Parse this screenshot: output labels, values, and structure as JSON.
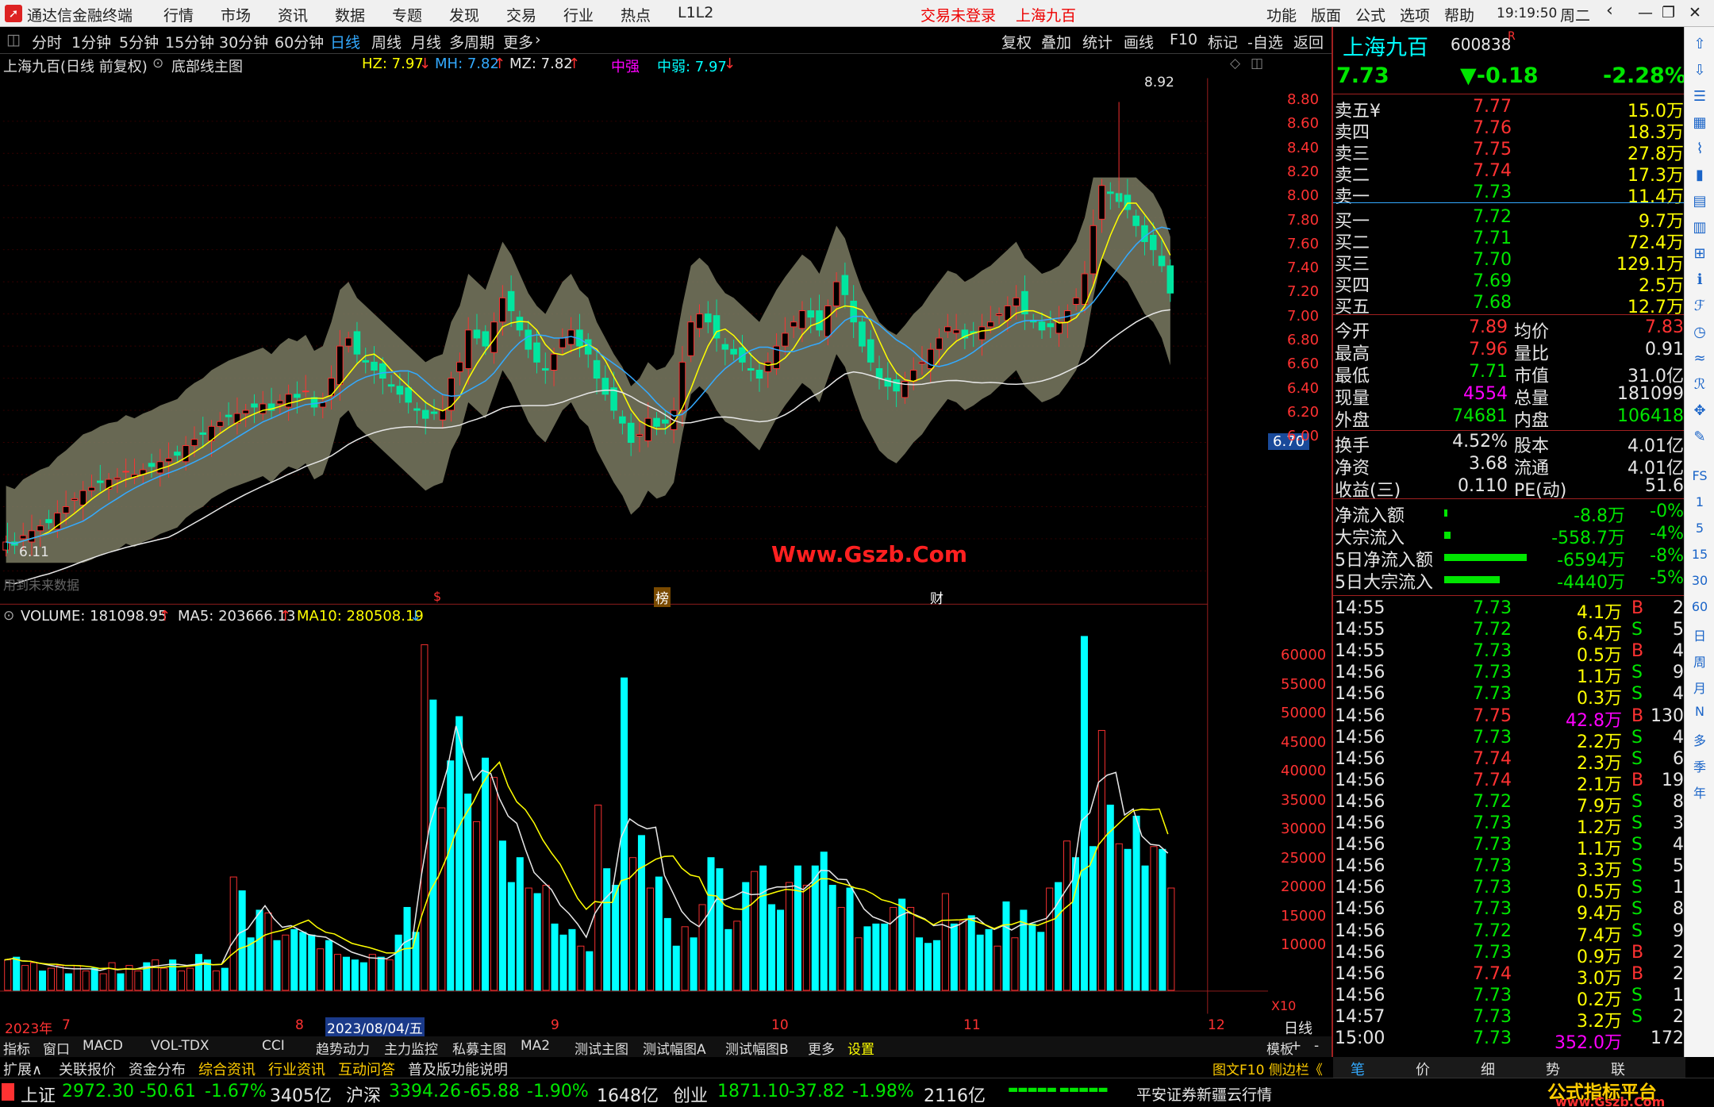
{
  "app": {
    "title": "通达信金融终端",
    "menus": [
      "行情",
      "市场",
      "资讯",
      "数据",
      "专题",
      "发现",
      "交易",
      "行业",
      "热点",
      "L1L2"
    ],
    "login": "交易未登录",
    "stock_name": "上海九百",
    "right_menus": [
      "功能",
      "版面",
      "公式",
      "选项",
      "帮助"
    ],
    "time": "19:19:50",
    "weekday": "周二"
  },
  "toolbar": {
    "periods": [
      "分时",
      "1分钟",
      "5分钟",
      "15分钟",
      "30分钟",
      "60分钟",
      "日线",
      "周线",
      "月线",
      "多周期",
      "更多"
    ],
    "active": "日线",
    "tools": [
      "复权",
      "叠加",
      "统计",
      "画线",
      "F10",
      "标记",
      "-自选",
      "返回"
    ]
  },
  "kline": {
    "title": "上海九百(日线 前复权)",
    "indicator": "底部线主图",
    "hz": "HZ: 7.97",
    "mh": "MH: 7.82",
    "mz": "MZ: 7.82",
    "zq": "中强",
    "zr": "中弱: 7.97",
    "price_label_high": "8.92",
    "price_label_low": "6.11",
    "current_tag": "6.70",
    "watermark": "Www.Gszb.Com",
    "note": "用到未来数据",
    "markers": [
      "$",
      "榜",
      "财"
    ]
  },
  "chart_data": [
    {
      "type": "candlestick",
      "title": "上海九百(日线 前复权)",
      "ylim": [
        6.0,
        8.9
      ],
      "yticks": [
        "8.80",
        "8.60",
        "8.40",
        "8.20",
        "8.00",
        "7.80",
        "7.60",
        "7.40",
        "7.20",
        "7.00",
        "6.80",
        "6.60",
        "6.40",
        "6.20",
        "6.00"
      ],
      "high": 8.92,
      "low": 6.11
    },
    {
      "type": "bar",
      "title": "VOLUME: 181098.95",
      "series": [
        {
          "name": "MA5: 203666.13"
        },
        {
          "name": "MA10: 280508.19"
        }
      ],
      "yticks": [
        "60000",
        "55000",
        "50000",
        "45000",
        "40000",
        "35000",
        "30000",
        "25000",
        "20000",
        "15000",
        "10000"
      ],
      "unit": "X10",
      "values": [
        5500,
        6000,
        4500,
        5000,
        3500,
        4000,
        4500,
        3000,
        4500,
        3500,
        4000,
        3000,
        5000,
        3000,
        4500,
        3500,
        5000,
        5500,
        4000,
        5500,
        3500,
        4000,
        6500,
        5500,
        3500,
        4000,
        20500,
        18000,
        9500,
        14500,
        14000,
        9000,
        10000,
        11000,
        10500,
        10000,
        7500,
        9000,
        6500,
        6000,
        5500,
        5000,
        6500,
        6000,
        5500,
        10000,
        15000,
        10500,
        62500,
        52500,
        33000,
        41500,
        49500,
        35500,
        30500,
        42000,
        38500,
        27000,
        19500,
        24000,
        18500,
        17500,
        19000,
        12000,
        10000,
        11000,
        8000,
        7000,
        33500,
        22000,
        19000,
        56500,
        24000,
        28000,
        18500,
        20500,
        13000,
        8000,
        11500,
        9500,
        15500,
        24000,
        22000,
        11000,
        12500,
        19500,
        21500,
        22500,
        15500,
        14500,
        19500,
        22500,
        19000,
        22500,
        25000,
        19000,
        15000,
        18500,
        9500,
        11500,
        12000,
        12000,
        15000,
        16500,
        15000,
        9500,
        8500,
        9000,
        17500,
        12000,
        12500,
        13500,
        10000,
        11000,
        8000,
        16000,
        9500,
        14500,
        12000,
        10500,
        18500,
        19500,
        27000,
        24000,
        64000,
        26000,
        47000,
        33500,
        26500,
        25500,
        31500,
        22500,
        26000,
        25500,
        18500
      ]
    },
    {
      "type": "line",
      "x_labels": [
        "2023年",
        "7",
        "8",
        "2023/08/04/五",
        "9",
        "10",
        "11",
        "12"
      ],
      "axis_right": "日线"
    }
  ],
  "bottom": {
    "tabs1": [
      "指标",
      "窗口",
      "MACD",
      "VOL-TDX",
      "CCI",
      "趋势动力",
      "主力监控",
      "私募主图",
      "MA2",
      "测试主图",
      "测试幅图A",
      "测试幅图B",
      "更多",
      "设置"
    ],
    "tabs1_right": [
      "模板",
      "+",
      "-"
    ],
    "tabs2": [
      "扩展∧",
      "关联报价",
      "资金分布",
      "综合资讯",
      "行业资讯",
      "互动问答",
      "普及版功能说明"
    ],
    "tabs2_right": "图文F10 侧边栏《"
  },
  "quote": {
    "name": "上海九百",
    "code": "600838",
    "badge": "R",
    "price": "7.73",
    "change": "▼-0.18",
    "pct": "-2.28%",
    "sells": [
      [
        "卖五¥",
        "7.77",
        "15.0万"
      ],
      [
        "卖四",
        "7.76",
        "18.3万"
      ],
      [
        "卖三",
        "7.75",
        "27.8万"
      ],
      [
        "卖二",
        "7.74",
        "17.3万"
      ],
      [
        "卖一",
        "7.73",
        "11.4万"
      ]
    ],
    "buys": [
      [
        "买一",
        "7.72",
        "9.7万"
      ],
      [
        "买二",
        "7.71",
        "72.4万"
      ],
      [
        "买三",
        "7.70",
        "129.1万"
      ],
      [
        "买四",
        "7.69",
        "2.5万"
      ],
      [
        "买五",
        "7.68",
        "12.7万"
      ]
    ],
    "stats": [
      [
        "今开",
        "7.89",
        "均价",
        "7.83"
      ],
      [
        "最高",
        "7.96",
        "量比",
        "0.91"
      ],
      [
        "最低",
        "7.71",
        "市值",
        "31.0亿"
      ],
      [
        "现量",
        "4554",
        "总量",
        "181099"
      ],
      [
        "外盘",
        "74681",
        "内盘",
        "106418"
      ]
    ],
    "stats2": [
      [
        "换手",
        "4.52%",
        "股本",
        "4.01亿"
      ],
      [
        "净资",
        "3.68",
        "流通",
        "4.01亿"
      ],
      [
        "收益(三)",
        "0.110",
        "PE(动)",
        "51.6"
      ]
    ],
    "flows": [
      [
        "净流入额",
        "-8.8万",
        "-0%"
      ],
      [
        "大宗流入",
        "-558.7万",
        "-4%"
      ],
      [
        "5日净流入额",
        "-6594万",
        "-8%"
      ],
      [
        "5日大宗流入",
        "-4440万",
        "-5%"
      ]
    ],
    "ticks": [
      [
        "14:55",
        "7.73",
        "4.1万",
        "B",
        "2"
      ],
      [
        "14:55",
        "7.72",
        "6.4万",
        "S",
        "5"
      ],
      [
        "14:55",
        "7.73",
        "0.5万",
        "B",
        "4"
      ],
      [
        "14:56",
        "7.73",
        "1.1万",
        "S",
        "9"
      ],
      [
        "14:56",
        "7.73",
        "0.3万",
        "S",
        "4"
      ],
      [
        "14:56",
        "7.75",
        "42.8万",
        "B",
        "130"
      ],
      [
        "14:56",
        "7.73",
        "2.2万",
        "S",
        "4"
      ],
      [
        "14:56",
        "7.74",
        "2.3万",
        "S",
        "6"
      ],
      [
        "14:56",
        "7.74",
        "2.1万",
        "B",
        "19"
      ],
      [
        "14:56",
        "7.72",
        "7.9万",
        "S",
        "8"
      ],
      [
        "14:56",
        "7.73",
        "1.2万",
        "S",
        "3"
      ],
      [
        "14:56",
        "7.73",
        "1.1万",
        "S",
        "4"
      ],
      [
        "14:56",
        "7.73",
        "3.3万",
        "S",
        "5"
      ],
      [
        "14:56",
        "7.73",
        "0.5万",
        "S",
        "1"
      ],
      [
        "14:56",
        "7.73",
        "9.4万",
        "S",
        "8"
      ],
      [
        "14:56",
        "7.72",
        "7.4万",
        "S",
        "9"
      ],
      [
        "14:56",
        "7.73",
        "0.9万",
        "B",
        "2"
      ],
      [
        "14:56",
        "7.74",
        "3.0万",
        "B",
        "2"
      ],
      [
        "14:56",
        "7.73",
        "0.2万",
        "S",
        "1"
      ],
      [
        "14:57",
        "7.73",
        "3.2万",
        "S",
        "2"
      ],
      [
        "15:00",
        "7.73",
        "352.0万",
        "",
        "172"
      ]
    ],
    "bottom_tabs": [
      "笔",
      "价",
      "细",
      "势",
      "联"
    ]
  },
  "status": {
    "sh_name": "上证",
    "sh": "2972.30",
    "sh_chg": "-50.61",
    "sh_pct": "-1.67%",
    "sh_amt": "3405亿",
    "sz_name": "沪深",
    "sz": "3394.26",
    "sz_chg": "-65.88",
    "sz_pct": "-1.90%",
    "sz_amt": "1648亿",
    "cy_name": "创业",
    "cy": "1871.10",
    "cy_chg": "-37.82",
    "cy_pct": "-1.98%",
    "cy_amt": "2116亿",
    "broker": "平安证券新疆云行情",
    "brand": "公式指标平台",
    "brand_url": "www.Gszb.Com"
  },
  "sidebar": [
    "arrow-up-icon",
    "arrow-down-icon",
    "list-icon",
    "grid-icon",
    "chart-icon",
    "candle-icon",
    "report-icon",
    "f10-icon",
    "table-icon",
    "info-icon",
    "fs-icon",
    "clock-icon",
    "wave-icon",
    "rsi-icon",
    "move-icon",
    "pen-icon"
  ],
  "sidebar_labels": [
    "FS",
    "1",
    "5",
    "15",
    "30",
    "60",
    "日",
    "周",
    "月",
    "N",
    "多",
    "季",
    "年"
  ],
  "colors": {
    "up": "#ff3232",
    "down": "#00ffff",
    "ma5": "#ffffff",
    "ma10": "#ffff00",
    "band": "#808060"
  }
}
